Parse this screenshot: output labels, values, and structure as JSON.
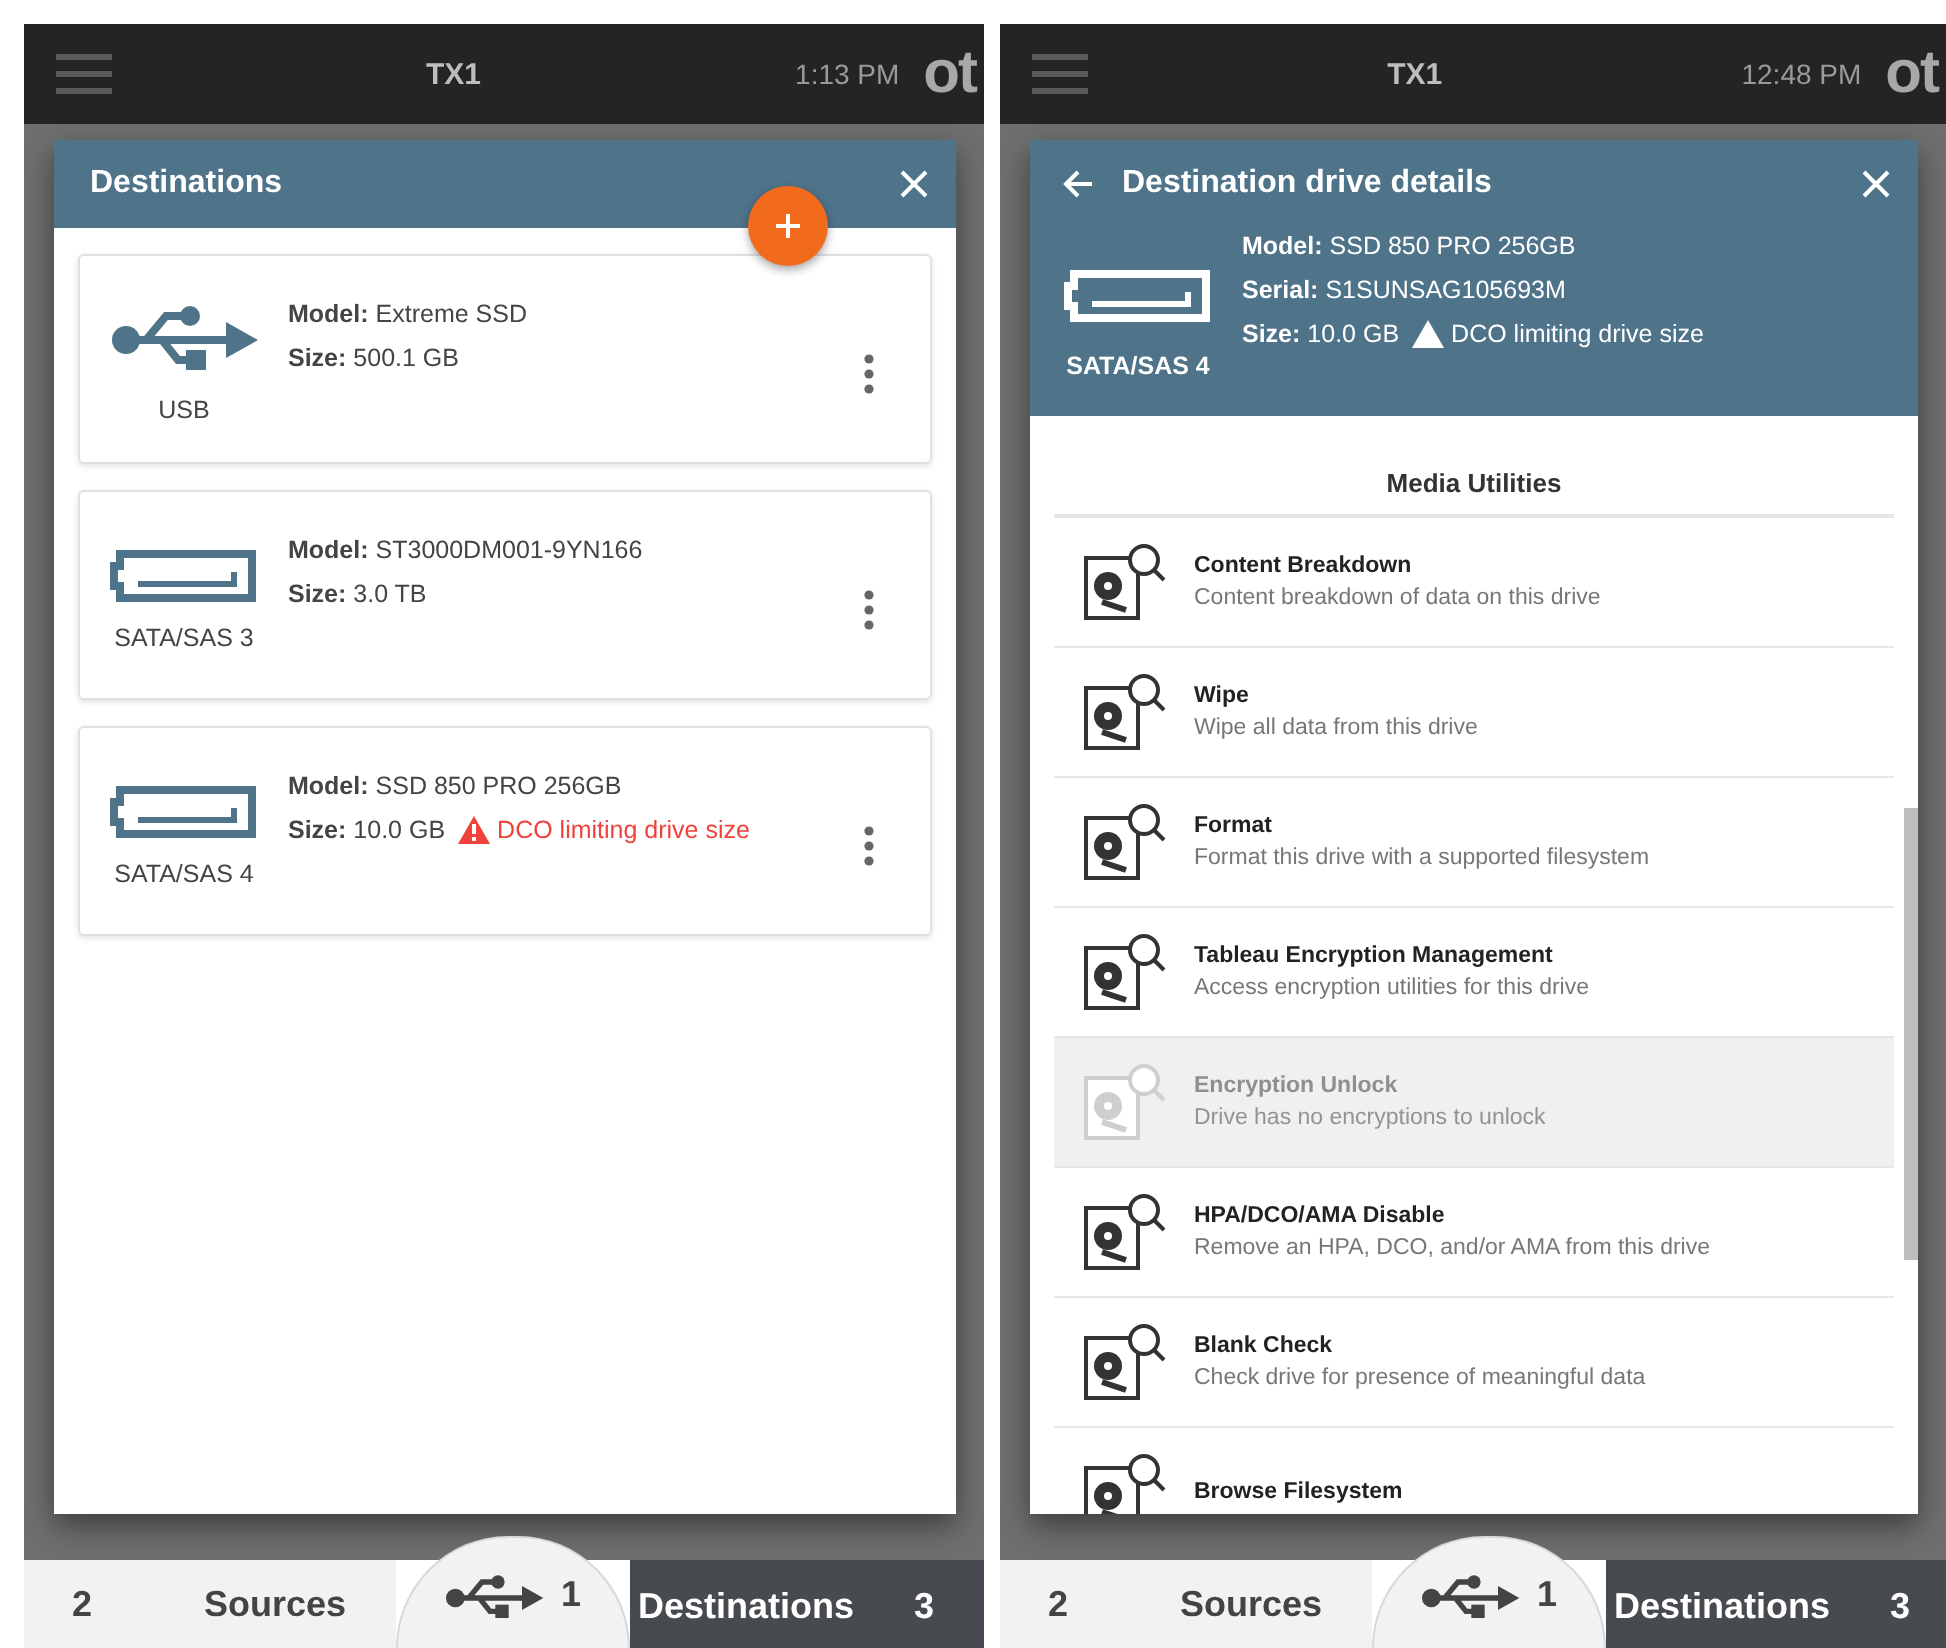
{
  "screens": [
    {
      "kind": "list",
      "header": {
        "title": "TX1",
        "time": "1:13 PM",
        "logo": "ot"
      },
      "dialog": {
        "title": "Destinations",
        "drives": [
          {
            "kind": "usb",
            "port": "USB",
            "fields": [
              {
                "label": "Model:",
                "value": "Extreme SSD"
              },
              {
                "label": "Size:",
                "value": "500.1 GB"
              }
            ]
          },
          {
            "kind": "sata",
            "port": "SATA/SAS 3",
            "fields": [
              {
                "label": "Model:",
                "value": "ST3000DM001-9YN166"
              },
              {
                "label": "Size:",
                "value": "3.0 TB"
              }
            ]
          },
          {
            "kind": "sata",
            "port": "SATA/SAS 4",
            "fields": [
              {
                "label": "Model:",
                "value": "SSD 850 PRO 256GB"
              },
              {
                "label": "Size:",
                "value": "10.0 GB",
                "warning": "DCO limiting drive size"
              }
            ]
          }
        ]
      },
      "bottom_nav": {
        "center_count": "1",
        "tabs": [
          {
            "count": "2",
            "label": "Sources",
            "selected": false
          },
          {
            "label": "Destinations",
            "count": "3",
            "selected": true
          }
        ]
      }
    },
    {
      "kind": "details",
      "header": {
        "title": "TX1",
        "time": "12:48 PM",
        "logo": "ot"
      },
      "dialog": {
        "title": "Destination drive details",
        "port": "SATA/SAS 4",
        "fields": [
          {
            "label": "Model:",
            "value": "SSD 850 PRO 256GB"
          },
          {
            "label": "Serial:",
            "value": "S1SUNSAG105693M"
          },
          {
            "label": "Size:",
            "value": "10.0 GB",
            "warning": "DCO limiting drive size"
          }
        ],
        "section_title": "Media Utilities",
        "utilities": [
          {
            "title": "Content Breakdown",
            "description": "Content breakdown of data on this drive",
            "disabled": false
          },
          {
            "title": "Wipe",
            "description": "Wipe all data from this drive",
            "disabled": false
          },
          {
            "title": "Format",
            "description": "Format this drive with a supported filesystem",
            "disabled": false
          },
          {
            "title": "Tableau Encryption Management",
            "description": "Access encryption utilities for this drive",
            "disabled": false
          },
          {
            "title": "Encryption Unlock",
            "description": "Drive has no encryptions to unlock",
            "disabled": true
          },
          {
            "title": "HPA/DCO/AMA Disable",
            "description": "Remove an HPA, DCO, and/or AMA from this drive",
            "disabled": false
          },
          {
            "title": "Blank Check",
            "description": "Check drive for presence of meaningful data",
            "disabled": false
          },
          {
            "title": "Browse Filesystem",
            "disabled": false
          }
        ]
      },
      "bottom_nav": {
        "center_count": "1",
        "tabs": [
          {
            "count": "2",
            "label": "Sources",
            "selected": false
          },
          {
            "label": "Destinations",
            "count": "3",
            "selected": true
          }
        ]
      }
    }
  ]
}
